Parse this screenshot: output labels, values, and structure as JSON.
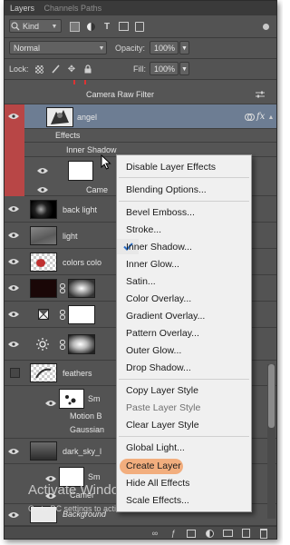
{
  "panel": {
    "tab_text": "Layers",
    "tab_rest": "Channels   Paths",
    "filter_kind": "Kind",
    "blend_mode": "Normal",
    "opacity_label": "Opacity:",
    "opacity_value": "100%",
    "lock_label": "Lock:",
    "fill_label": "Fill:",
    "fill_value": "100%"
  },
  "layers": {
    "camera_raw_filter": "Camera Raw Filter",
    "angel": "angel",
    "effects": "Effects",
    "inner_shadow": "Inner Shadow",
    "camera_partial": "Came",
    "back_light": "back light",
    "light": "light",
    "colors_color": "colors colo",
    "feathers": "feathers",
    "smart_partial": "Sm",
    "motion_blur_partial": "Motion B",
    "gaussian_partial": "Gaussian",
    "dark_sky": "dark_sky_l",
    "smart2_partial": "Sm",
    "camera2_partial": "Camer",
    "background": "Background",
    "fx": "fx"
  },
  "context_menu": {
    "items": [
      "Disable Layer Effects",
      "Blending Options...",
      "Bevel  Emboss...",
      "Stroke...",
      "Inner Shadow...",
      "Inner Glow...",
      "Satin...",
      "Color Overlay...",
      "Gradient Overlay...",
      "Pattern Overlay...",
      "Outer Glow...",
      "Drop Shadow...",
      "Copy Layer Style",
      "Paste Layer Style",
      "Clear Layer Style",
      "Global Light...",
      "Create Layer",
      "Hide All Effects",
      "Scale Effects..."
    ],
    "checked_item": "Inner Shadow...",
    "highlighted_item": "Create Layer",
    "disabled_item": "Paste Layer Style"
  },
  "watermark": {
    "line1": "Activate Windows",
    "line2": "Go to PC settings to activate Windows."
  },
  "colors": {
    "panel_bg": "#535353",
    "selected_row": "#6d7d93",
    "red_group": "#b84646",
    "highlight": "#f2a26a",
    "menu_bg": "#f0f0f0"
  }
}
